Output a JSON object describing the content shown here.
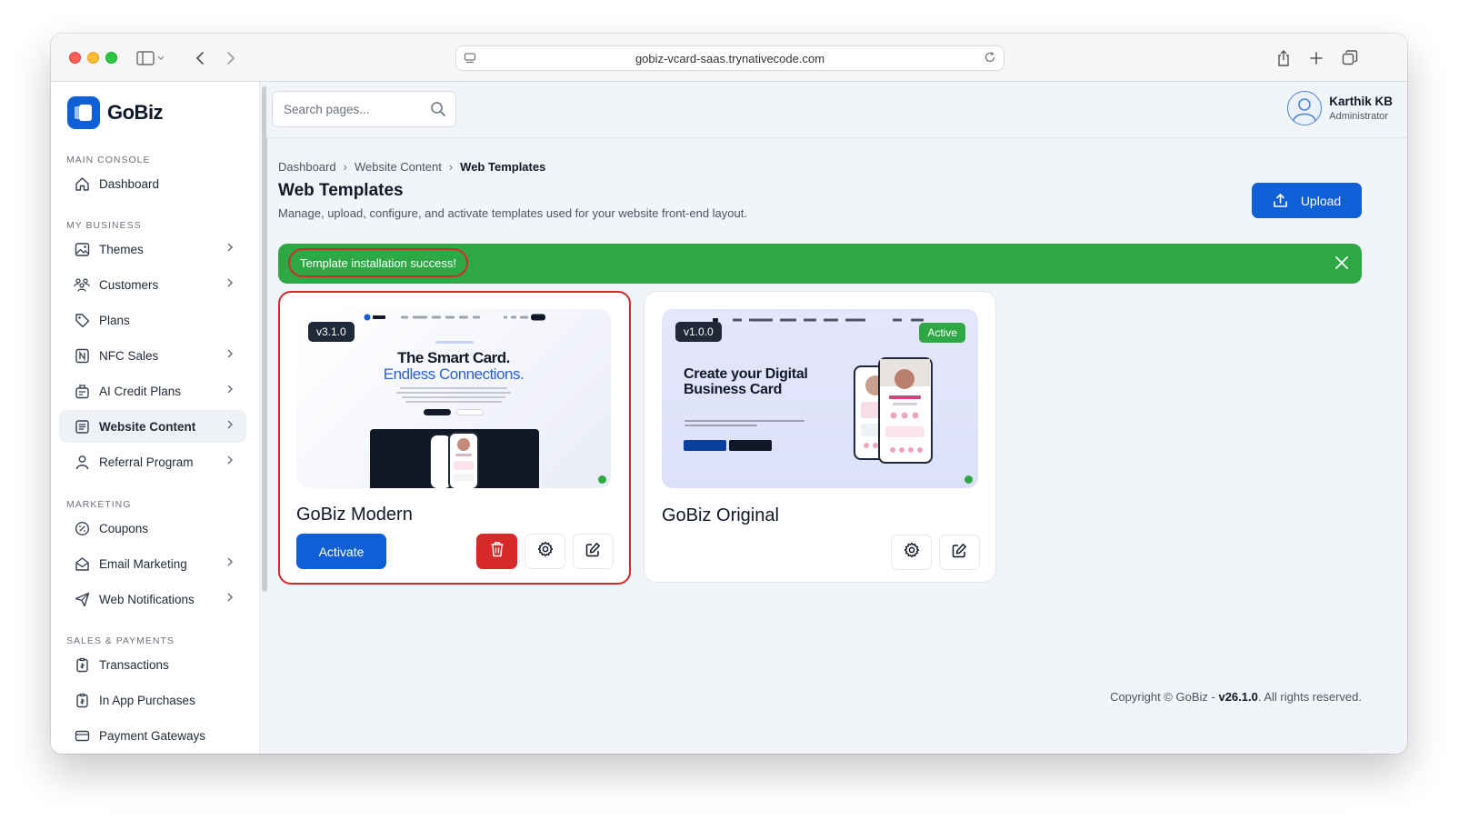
{
  "browser": {
    "url": "gobiz-vcard-saas.trynativecode.com"
  },
  "brand": {
    "name": "GoBiz",
    "accent_color": "#0f5fd6"
  },
  "sidebar": {
    "sections": {
      "main": "MAIN CONSOLE",
      "business": "MY BUSINESS",
      "marketing": "MARKETING",
      "sales": "SALES & PAYMENTS"
    },
    "items": [
      {
        "label": "Dashboard",
        "icon": "home-icon"
      },
      {
        "label": "Themes",
        "icon": "image-icon"
      },
      {
        "label": "Customers",
        "icon": "users-icon"
      },
      {
        "label": "Plans",
        "icon": "tag-icon"
      },
      {
        "label": "NFC Sales",
        "icon": "nfc-icon"
      },
      {
        "label": "AI Credit Plans",
        "icon": "credit-icon"
      },
      {
        "label": "Website Content",
        "icon": "document-icon"
      },
      {
        "label": "Referral Program",
        "icon": "user-icon"
      },
      {
        "label": "Coupons",
        "icon": "coupon-icon"
      },
      {
        "label": "Email Marketing",
        "icon": "mail-icon"
      },
      {
        "label": "Web Notifications",
        "icon": "send-icon"
      },
      {
        "label": "Transactions",
        "icon": "receipt-icon"
      },
      {
        "label": "In App Purchases",
        "icon": "receipt-icon"
      },
      {
        "label": "Payment Gateways",
        "icon": "card-icon"
      }
    ]
  },
  "header": {
    "search_placeholder": "Search pages...",
    "user": {
      "name": "Karthik KB",
      "role": "Administrator"
    }
  },
  "page": {
    "breadcrumb": [
      "Dashboard",
      "Website Content",
      "Web Templates"
    ],
    "title": "Web Templates",
    "description": "Manage, upload, configure, and activate templates used for your website front-end layout.",
    "upload_label": "Upload"
  },
  "alert": {
    "message": "Template installation success!",
    "color": "#2ea844"
  },
  "templates": [
    {
      "name": "GoBiz Modern",
      "version": "v3.1.0",
      "activate_label": "Activate",
      "preview": {
        "headline_1": "The Smart Card.",
        "headline_2": "Endless Connections."
      }
    },
    {
      "name": "GoBiz Original",
      "version": "v1.0.0",
      "status": "Active",
      "preview": {
        "headline": "Create your Digital Business Card"
      }
    }
  ],
  "footer": {
    "prefix": "Copyright © GoBiz - ",
    "version": "v26.1.0",
    "suffix": ". All rights reserved."
  }
}
